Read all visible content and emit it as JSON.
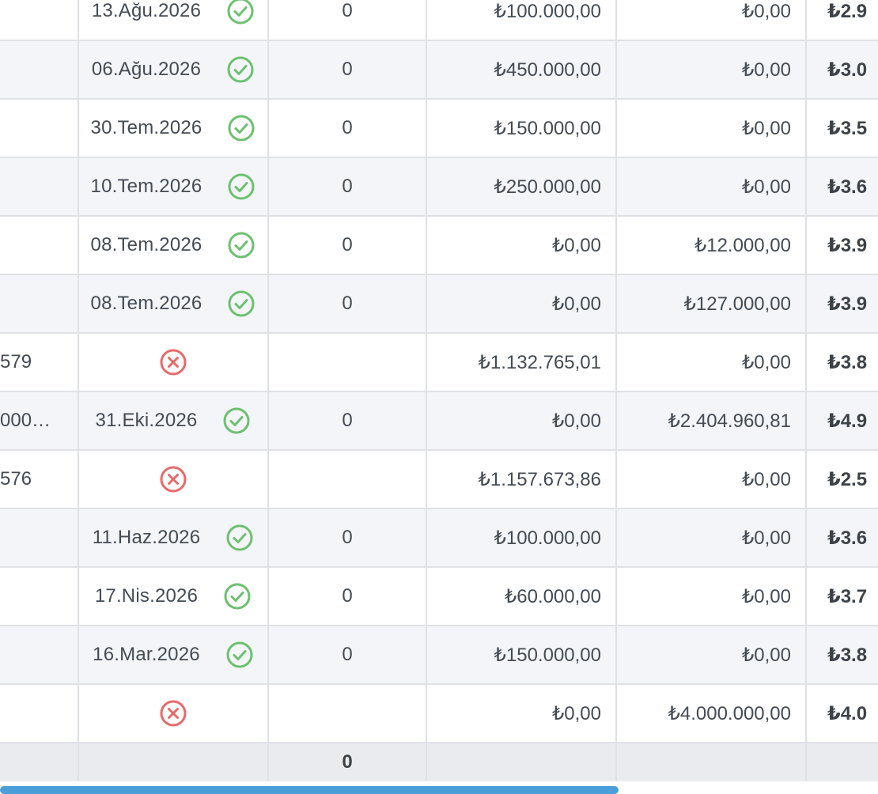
{
  "rows": [
    {
      "c1": "",
      "date": "13.Ağu.2026",
      "status": "ok",
      "qty": "0",
      "amount1": "₺100.000,00",
      "amount2": "₺0,00",
      "total": "₺2.9"
    },
    {
      "c1": "",
      "date": "06.Ağu.2026",
      "status": "ok",
      "qty": "0",
      "amount1": "₺450.000,00",
      "amount2": "₺0,00",
      "total": "₺3.0"
    },
    {
      "c1": "",
      "date": "30.Tem.2026",
      "status": "ok",
      "qty": "0",
      "amount1": "₺150.000,00",
      "amount2": "₺0,00",
      "total": "₺3.5"
    },
    {
      "c1": "",
      "date": "10.Tem.2026",
      "status": "ok",
      "qty": "0",
      "amount1": "₺250.000,00",
      "amount2": "₺0,00",
      "total": "₺3.6"
    },
    {
      "c1": "",
      "date": "08.Tem.2026",
      "status": "ok",
      "qty": "0",
      "amount1": "₺0,00",
      "amount2": "₺12.000,00",
      "total": "₺3.9"
    },
    {
      "c1": "",
      "date": "08.Tem.2026",
      "status": "ok",
      "qty": "0",
      "amount1": "₺0,00",
      "amount2": "₺127.000,00",
      "total": "₺3.9"
    },
    {
      "c1": "579",
      "date": "",
      "status": "fail",
      "qty": "",
      "amount1": "₺1.132.765,01",
      "amount2": "₺0,00",
      "total": "₺3.8"
    },
    {
      "c1": "000…",
      "date": "31.Eki.2026",
      "status": "ok",
      "qty": "0",
      "amount1": "₺0,00",
      "amount2": "₺2.404.960,81",
      "total": "₺4.9"
    },
    {
      "c1": "576",
      "date": "",
      "status": "fail",
      "qty": "",
      "amount1": "₺1.157.673,86",
      "amount2": "₺0,00",
      "total": "₺2.5"
    },
    {
      "c1": "",
      "date": "11.Haz.2026",
      "status": "ok",
      "qty": "0",
      "amount1": "₺100.000,00",
      "amount2": "₺0,00",
      "total": "₺3.6"
    },
    {
      "c1": "",
      "date": "17.Nis.2026",
      "status": "ok",
      "qty": "0",
      "amount1": "₺60.000,00",
      "amount2": "₺0,00",
      "total": "₺3.7"
    },
    {
      "c1": "",
      "date": "16.Mar.2026",
      "status": "ok",
      "qty": "0",
      "amount1": "₺150.000,00",
      "amount2": "₺0,00",
      "total": "₺3.8"
    },
    {
      "c1": "",
      "date": "",
      "status": "fail",
      "qty": "",
      "amount1": "₺0,00",
      "amount2": "₺4.000.000,00",
      "total": "₺4.0"
    }
  ],
  "footer": {
    "qty_total": "0"
  },
  "icons": {
    "ok": "check-circle-icon",
    "fail": "x-circle-icon"
  },
  "colors": {
    "ok": "#6cc070",
    "fail": "#e66a6a",
    "scrollbar": "#4a9fd8"
  }
}
